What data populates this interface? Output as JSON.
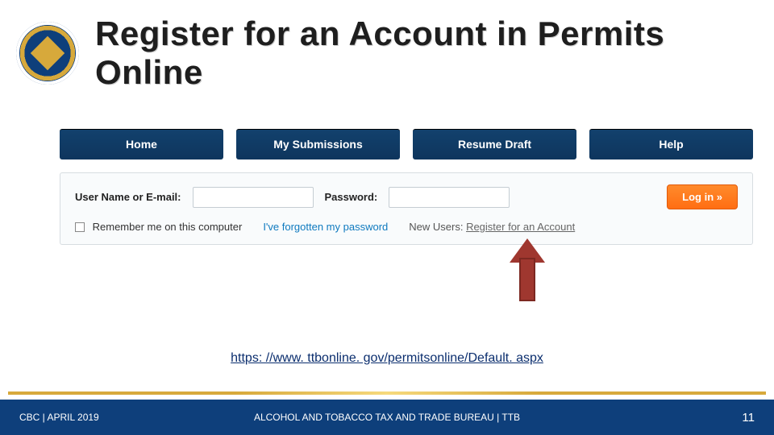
{
  "header": {
    "title": "Register for an Account in Permits Online",
    "seal_alt": "TTB Seal"
  },
  "nav": {
    "items": [
      {
        "label": "Home"
      },
      {
        "label": "My Submissions"
      },
      {
        "label": "Resume Draft"
      },
      {
        "label": "Help"
      }
    ]
  },
  "login": {
    "username_label": "User Name or E-mail:",
    "password_label": "Password:",
    "login_button": "Log in »",
    "remember_label": "Remember me on this computer",
    "forgot_label": "I've forgotten my password",
    "new_users_prefix": "New Users: ",
    "new_users_link": "Register for an Account"
  },
  "url": "https: //www. ttbonline. gov/permitsonline/Default. aspx",
  "footer": {
    "left": "CBC | APRIL 2019",
    "center": "ALCOHOL AND TOBACCO TAX AND TRADE BUREAU | TTB",
    "page": "11"
  }
}
